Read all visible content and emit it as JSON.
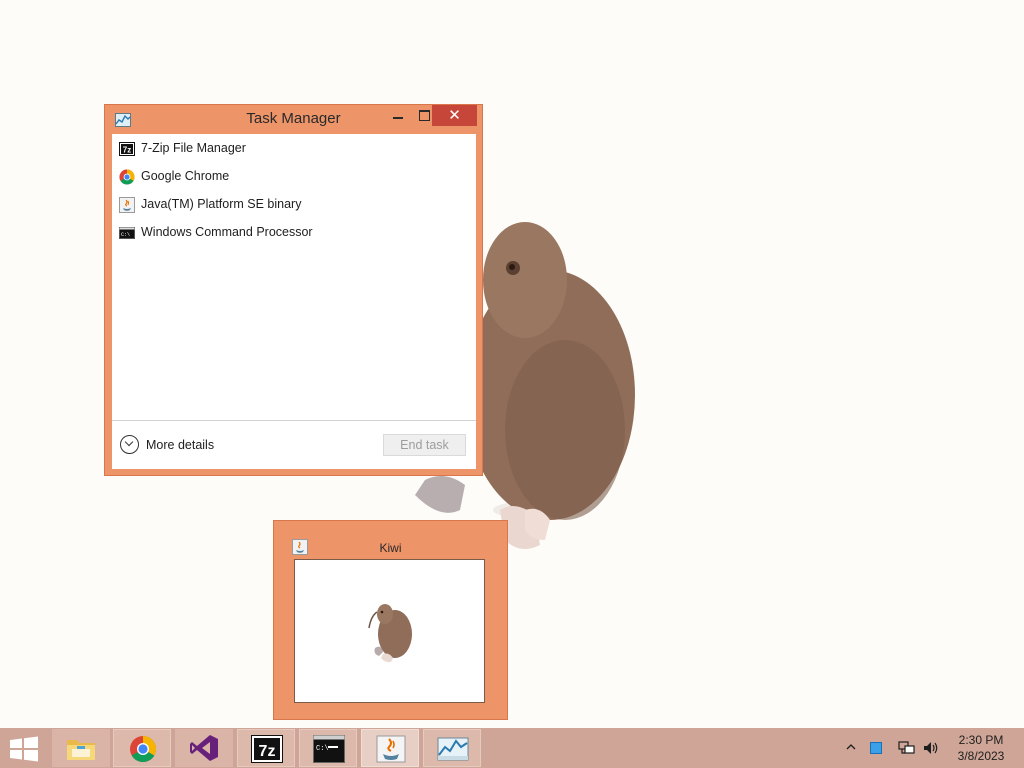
{
  "task_manager": {
    "title": "Task Manager",
    "close_glyph": "✕",
    "processes": [
      {
        "name": "7-Zip File Manager",
        "icon": "7zip-icon"
      },
      {
        "name": "Google Chrome",
        "icon": "chrome-icon"
      },
      {
        "name": "Java(TM) Platform SE binary",
        "icon": "java-icon"
      },
      {
        "name": "Windows Command Processor",
        "icon": "cmd-icon"
      }
    ],
    "more_details_label": "More details",
    "end_task_label": "End task"
  },
  "kiwi_window": {
    "title": "Kiwi"
  },
  "taskbar": {
    "items": [
      {
        "name": "file-explorer",
        "icon": "folder-icon"
      },
      {
        "name": "google-chrome",
        "icon": "chrome-icon"
      },
      {
        "name": "visual-studio",
        "icon": "visual-studio-icon"
      },
      {
        "name": "7-zip",
        "icon": "7zip-icon"
      },
      {
        "name": "command-prompt",
        "icon": "cmd-icon"
      },
      {
        "name": "java",
        "icon": "java-icon"
      },
      {
        "name": "task-manager",
        "icon": "task-manager-icon"
      }
    ],
    "clock_time": "2:30 PM",
    "clock_date": "3/8/2023"
  },
  "colors": {
    "window_frame": "#ed9468",
    "taskbar": "#cfa597",
    "close_button": "#c7463a",
    "desktop": "#fdfcf9"
  },
  "icon_labels": {
    "sevenzip": "7z",
    "cmd_prompt": "C:\\"
  }
}
